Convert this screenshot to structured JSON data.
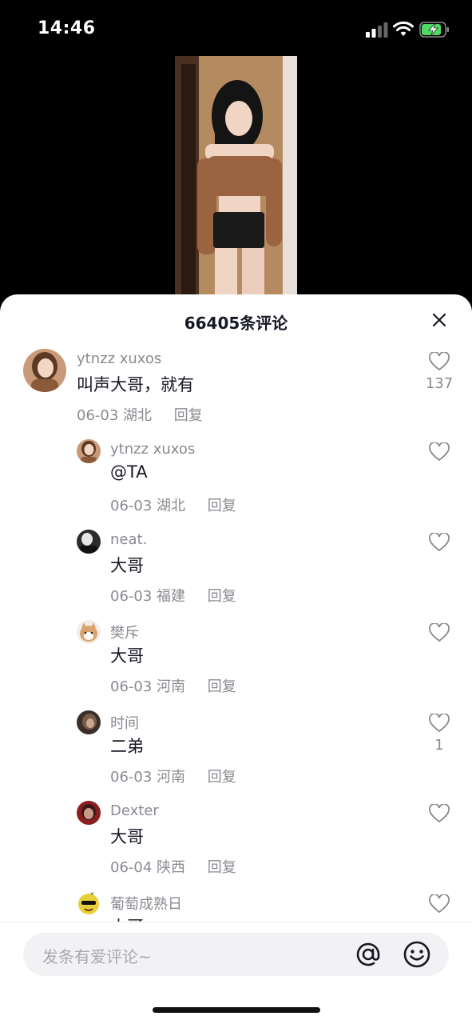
{
  "status": {
    "time": "14:46"
  },
  "sheet": {
    "title": "66405条评论",
    "close_icon": "close-icon"
  },
  "comments": [
    {
      "user": "ytnzz xuxos",
      "text": "叫声大哥，就有",
      "date": "06-03",
      "location": "湖北",
      "reply": "回复",
      "likes": "137",
      "avatar_color": "#b07a55",
      "level": "top"
    },
    {
      "user": "ytnzz xuxos",
      "text": "@TA",
      "date": "06-03",
      "location": "湖北",
      "reply": "回复",
      "likes": "",
      "avatar_color": "#b07a55",
      "level": "reply"
    },
    {
      "user": "neat.",
      "text": "大哥",
      "date": "06-03",
      "location": "福建",
      "reply": "回复",
      "likes": "",
      "avatar_color": "#3a3a3a",
      "level": "reply"
    },
    {
      "user": "樊斥",
      "text": "大哥",
      "date": "06-03",
      "location": "河南",
      "reply": "回复",
      "likes": "",
      "avatar_color": "#d9a46b",
      "level": "reply"
    },
    {
      "user": "时间",
      "text": "二弟",
      "date": "06-03",
      "location": "河南",
      "reply": "回复",
      "likes": "1",
      "avatar_color": "#5a4a40",
      "level": "reply"
    },
    {
      "user": "Dexter",
      "text": "大哥",
      "date": "06-04",
      "location": "陕西",
      "reply": "回复",
      "likes": "",
      "avatar_color": "#8b1e1e",
      "level": "reply"
    },
    {
      "user": "葡萄成熟日",
      "text": "大哥",
      "date": "",
      "location": "",
      "reply": "",
      "likes": "",
      "avatar_color": "#e8d03a",
      "level": "reply"
    }
  ],
  "input": {
    "placeholder": "发条有爱评论~",
    "at_icon": "at-icon",
    "emoji_icon": "emoji-icon"
  }
}
